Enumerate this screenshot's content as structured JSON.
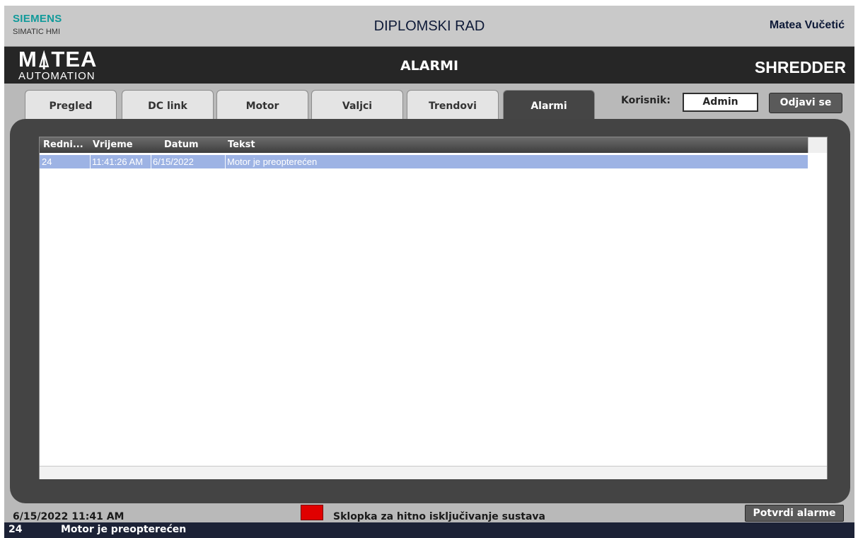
{
  "topbar": {
    "brand": "SIEMENS",
    "product": "SIMATIC HMI",
    "title": "DIPLOMSKI RAD",
    "user_name": "Matea Vučetić"
  },
  "header": {
    "logo_main": "M⍋TEA",
    "logo_sub": "AUTOMATION",
    "screen_title": "ALARMI",
    "machine": "SHREDDER"
  },
  "tabs": [
    {
      "label": "Pregled",
      "active": false
    },
    {
      "label": "DC link",
      "active": false
    },
    {
      "label": "Motor",
      "active": false
    },
    {
      "label": "Valjci",
      "active": false
    },
    {
      "label": "Trendovi",
      "active": false
    },
    {
      "label": "Alarmi",
      "active": true
    }
  ],
  "user": {
    "label": "Korisnik:",
    "value": "Admin",
    "logout_label": "Odjavi se"
  },
  "alarm_view": {
    "columns": [
      "Redni...",
      "Vrijeme",
      "Datum",
      "Tekst"
    ],
    "rows": [
      {
        "no": "24",
        "time": "11:41:26 AM",
        "date": "6/15/2022",
        "text": "Motor je preopterećen"
      }
    ]
  },
  "status": {
    "datetime": "6/15/2022 11:41 AM",
    "estop_label": "Sklopka za hitno isključivanje sustava",
    "estop_color": "#e00000",
    "ack_label": "Potvrdi alarme"
  },
  "alarm_line": {
    "no": "24",
    "text": "Motor je preopterećen"
  }
}
